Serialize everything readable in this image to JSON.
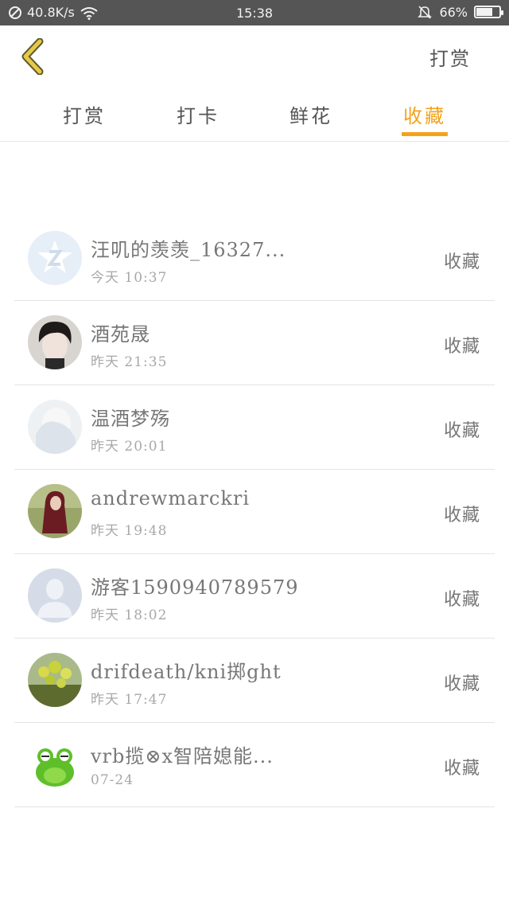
{
  "status_bar": {
    "net_speed": "40.8K/s",
    "time": "15:38",
    "battery": "66%",
    "battery_level": 0.66,
    "icons": [
      "no-sim-icon",
      "wifi-icon",
      "mute-bell-icon",
      "battery-icon"
    ]
  },
  "header": {
    "back_icon": "chevron-left-icon",
    "action_label": "打赏"
  },
  "colors": {
    "accent": "#f3a31a",
    "back_icon": "#e8c84a",
    "status_bar": "#555555"
  },
  "tabs": [
    {
      "label": "打赏",
      "active": false
    },
    {
      "label": "打卡",
      "active": false
    },
    {
      "label": "鲜花",
      "active": false
    },
    {
      "label": "收藏",
      "active": true
    }
  ],
  "list": [
    {
      "name": "汪叽的羡羡_16327...",
      "time": "今天 10:37",
      "action": "收藏",
      "avatar": "qq-logo-avatar"
    },
    {
      "name": "酒苑晟",
      "time": "昨天 21:35",
      "action": "收藏",
      "avatar": "dark-hair-person-avatar"
    },
    {
      "name": "温酒梦殇",
      "time": "昨天 20:01",
      "action": "收藏",
      "avatar": "pale-person-avatar"
    },
    {
      "name": "andrewmarckri",
      "time": "昨天 19:48",
      "action": "收藏",
      "avatar": "red-hair-person-avatar"
    },
    {
      "name": "游客1590940789579",
      "time": "昨天 18:02",
      "action": "收藏",
      "avatar": "default-user-avatar"
    },
    {
      "name": "drifdeath/kni掷ght",
      "time": "昨天 17:47",
      "action": "收藏",
      "avatar": "green-plant-avatar"
    },
    {
      "name": "vrb揽⊗x智陪媳能...",
      "time": "07-24",
      "action": "收藏",
      "avatar": "green-frog-avatar"
    }
  ]
}
